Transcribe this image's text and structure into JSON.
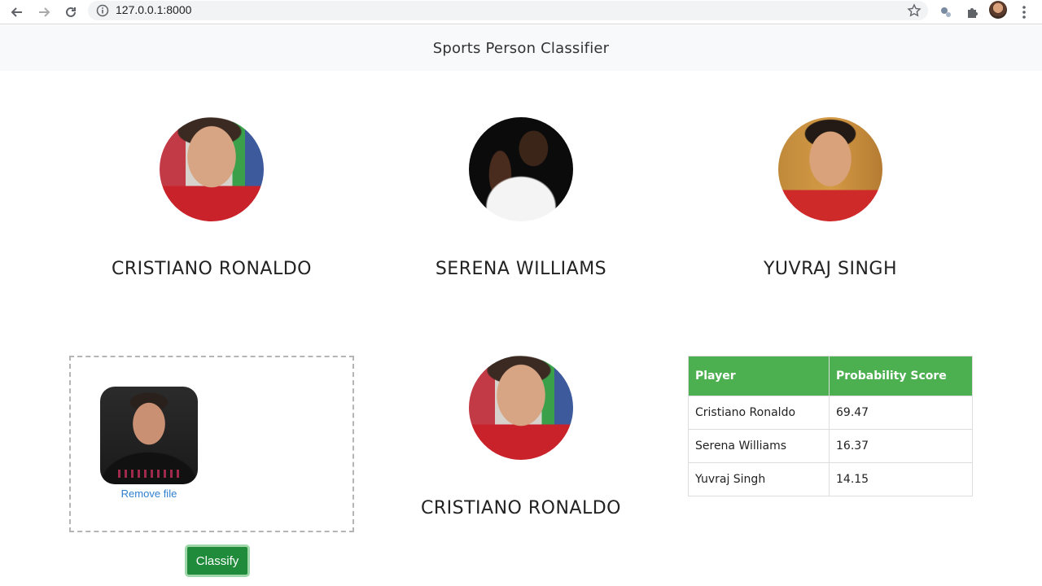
{
  "browser": {
    "url": "127.0.0.1:8000"
  },
  "navbar": {
    "title": "Sports Person Classifier"
  },
  "players": [
    {
      "name": "CRISTIANO RONALDO"
    },
    {
      "name": "SERENA WILLIAMS"
    },
    {
      "name": "YUVRAJ SINGH"
    }
  ],
  "upload": {
    "remove_label": "Remove file",
    "classify_label": "Classify"
  },
  "result": {
    "name": "CRISTIANO RONALDO"
  },
  "table": {
    "headers": [
      "Player",
      "Probability Score"
    ],
    "rows": [
      [
        "Cristiano Ronaldo",
        "69.47"
      ],
      [
        "Serena Williams",
        "16.37"
      ],
      [
        "Yuvraj Singh",
        "14.15"
      ]
    ]
  }
}
